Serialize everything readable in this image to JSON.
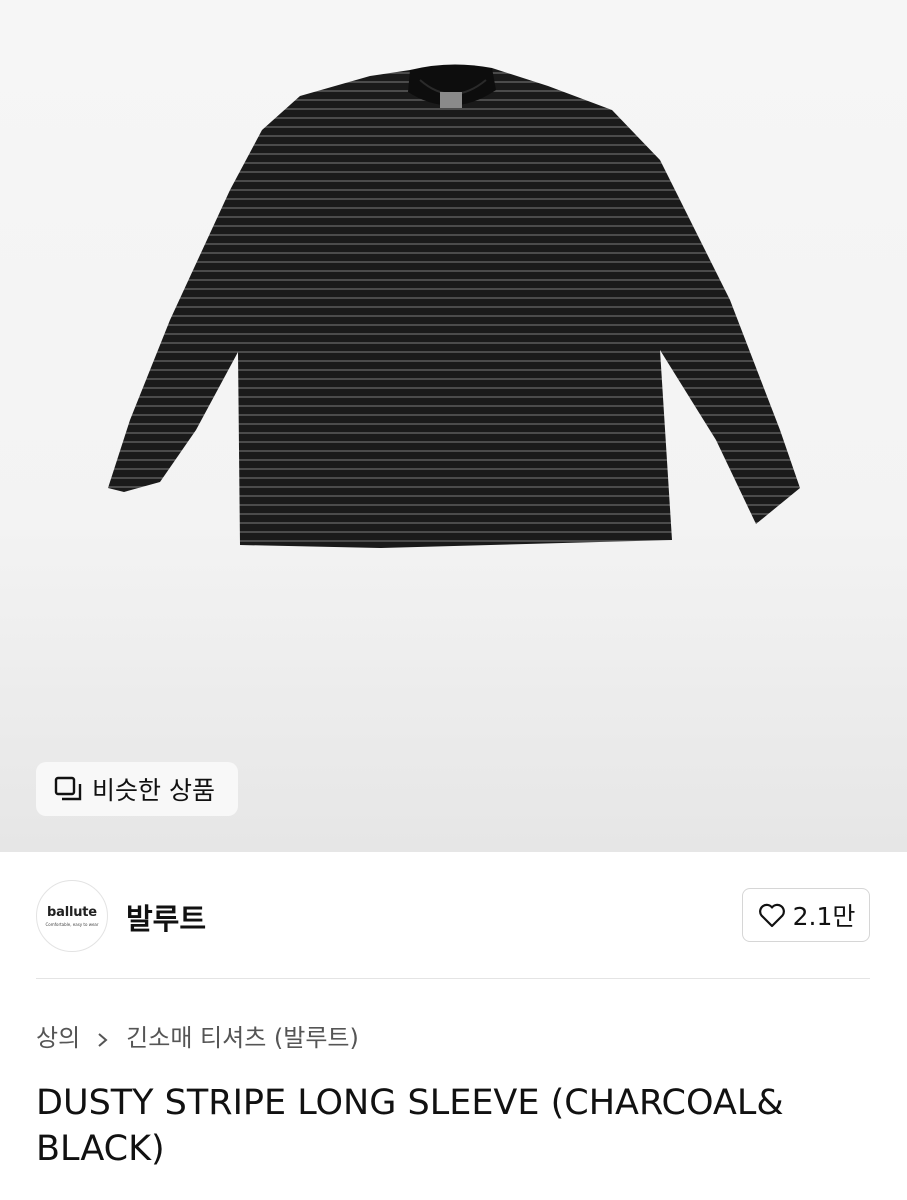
{
  "similar_button": {
    "label": "비슷한 상품",
    "icon": "similar-items-icon"
  },
  "brand": {
    "logo_name": "ballute",
    "logo_tagline": "Comfortable, easy to wear",
    "name": "발루트"
  },
  "like_button": {
    "count": "2.1만",
    "icon": "heart-icon"
  },
  "breadcrumb": {
    "category": "상의",
    "subcategory": "긴소매 티셔츠 (발루트)",
    "separator_icon": "chevron-right-icon"
  },
  "product": {
    "title": "DUSTY STRIPE LONG SLEEVE (CHARCOAL& BLACK)"
  },
  "colors": {
    "shirt": "#1b1b1b",
    "stripe": "#4a4a4a",
    "hero_bg": "#f3f3f3"
  }
}
